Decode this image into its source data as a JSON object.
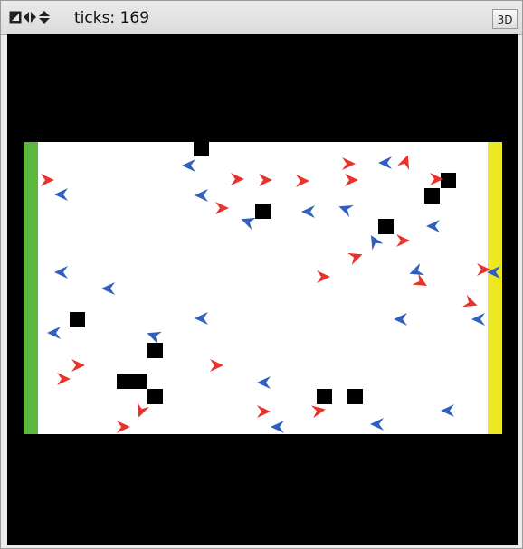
{
  "toolbar": {
    "ticks_label": "ticks: 169",
    "view_3d_label": "3D",
    "icons": [
      "zoom-icon",
      "horizontal-arrows-icon",
      "vertical-arrows-icon"
    ]
  },
  "world": {
    "background": "#000000",
    "arena_color": "#ffffff",
    "left_goal_color": "#5cb83c",
    "right_goal_color": "#eee820",
    "red_agent_color": "#e8322b",
    "blue_agent_color": "#2f5fbf",
    "obstacle_color": "#000000",
    "red_agent_count": 26,
    "blue_agent_count": 26,
    "obstacle_count": 13
  }
}
